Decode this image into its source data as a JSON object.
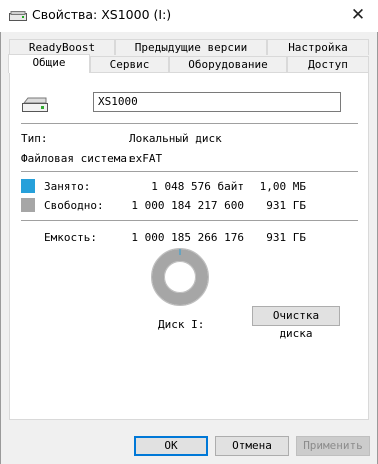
{
  "window": {
    "title": "Свойства: XS1000 (I:)",
    "close_glyph": "✕"
  },
  "tabs_row1": [
    {
      "label": "ReadyBoost"
    },
    {
      "label": "Предыдущие версии"
    },
    {
      "label": "Настройка"
    }
  ],
  "tabs_row2": [
    {
      "label": "Общие",
      "active": true
    },
    {
      "label": "Сервис"
    },
    {
      "label": "Оборудование"
    },
    {
      "label": "Доступ"
    }
  ],
  "general": {
    "volume_name": "XS1000",
    "type_label": "Тип:",
    "type_value": "Локальный диск",
    "fs_label": "Файловая система:",
    "fs_value": "exFAT",
    "used_label": "Занято:",
    "used_bytes": "1 048 576 байт",
    "used_size": "1,00 МБ",
    "free_label": "Свободно:",
    "free_bytes": "1 000 184 217 600",
    "free_size": "931 ГБ",
    "capacity_label": "Емкость:",
    "capacity_bytes": "1 000 185 266 176",
    "capacity_size": "931 ГБ",
    "disk_label": "Диск I:",
    "cleanup_button": "Очистка диска"
  },
  "colors": {
    "used": "#26a0da",
    "free": "#a6a6a6"
  },
  "footer": {
    "ok": "ОК",
    "cancel": "Отмена",
    "apply": "Применить"
  }
}
